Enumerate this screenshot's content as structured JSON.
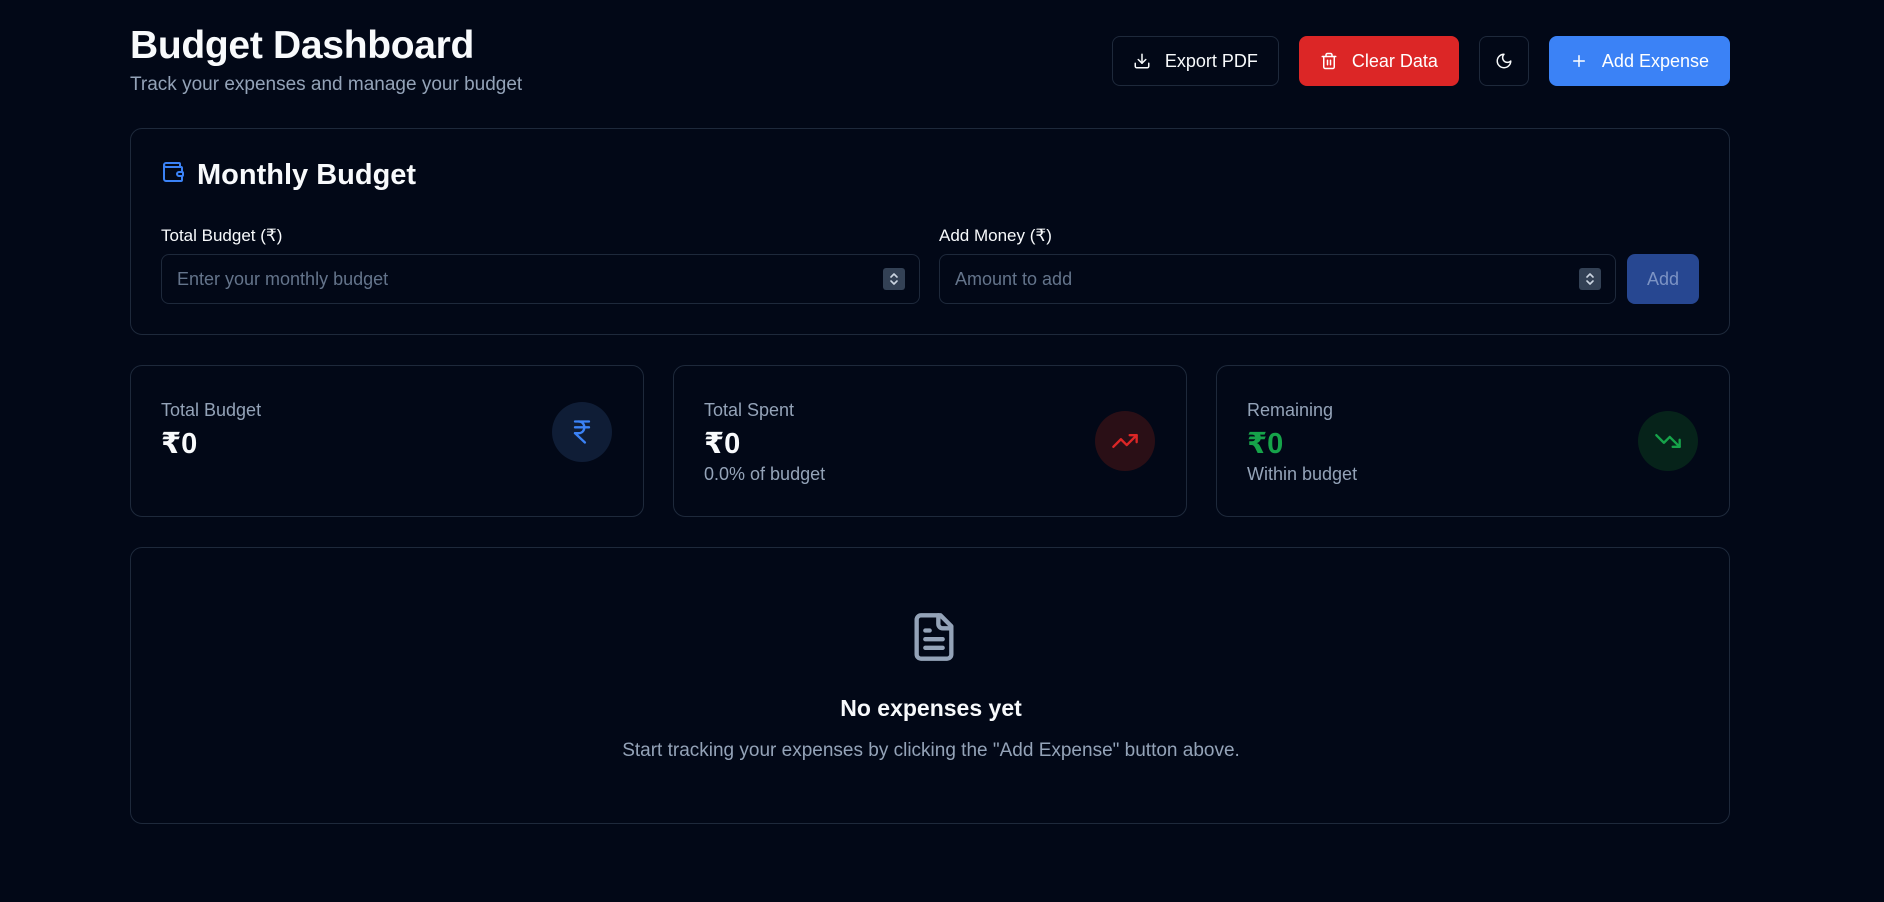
{
  "header": {
    "title": "Budget Dashboard",
    "subtitle": "Track your expenses and manage your budget",
    "export_label": "Export PDF",
    "clear_label": "Clear Data",
    "add_expense_label": "Add Expense"
  },
  "budget": {
    "title": "Monthly Budget",
    "total_label": "Total Budget (₹)",
    "total_placeholder": "Enter your monthly budget",
    "add_money_label": "Add Money (₹)",
    "add_money_placeholder": "Amount to add",
    "add_button": "Add"
  },
  "stats": [
    {
      "label": "Total Budget",
      "value": "₹0",
      "sub": ""
    },
    {
      "label": "Total Spent",
      "value": "₹0",
      "sub": "0.0% of budget"
    },
    {
      "label": "Remaining",
      "value": "₹0",
      "sub": "Within budget"
    }
  ],
  "empty": {
    "title": "No expenses yet",
    "text": "Start tracking your expenses by clicking the \"Add Expense\" button above."
  },
  "colors": {
    "background": "#020817",
    "accent_blue": "#3b82f6",
    "danger_red": "#dc2626",
    "success_green": "#16a34a"
  },
  "icons": {
    "export": "download-icon",
    "clear": "trash-icon",
    "theme": "moon-icon",
    "add": "plus-icon",
    "budget": "wallet-icon",
    "total_budget": "rupee-icon",
    "total_spent": "trending-up-icon",
    "remaining": "trending-down-icon",
    "empty": "file-text-icon"
  }
}
